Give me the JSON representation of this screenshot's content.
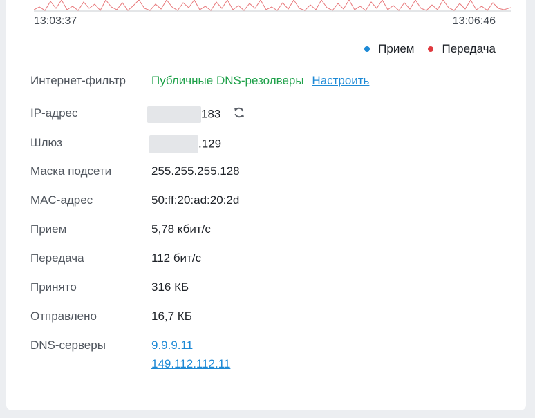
{
  "chart": {
    "time_start": "13:03:37",
    "time_end": "13:06:46",
    "legend": [
      {
        "label": "Прием",
        "color": "#1e8ad6"
      },
      {
        "label": "Передача",
        "color": "#e0393e"
      }
    ]
  },
  "info": {
    "filter_label": "Интернет-фильтр",
    "filter_value": "Публичные DNS-резолверы",
    "filter_link": "Настроить",
    "ip_label": "IP-адрес",
    "ip_suffix": "183",
    "gateway_label": "Шлюз",
    "gateway_suffix": ".129",
    "mask_label": "Маска подсети",
    "mask_value": "255.255.255.128",
    "mac_label": "MAC-адрес",
    "mac_value": "50:ff:20:ad:20:2d",
    "rx_label": "Прием",
    "rx_value": "5,78 кбит/с",
    "tx_label": "Передача",
    "tx_value": "112 бит/с",
    "received_label": "Принято",
    "received_value": "316 КБ",
    "sent_label": "Отправлено",
    "sent_value": "16,7 КБ",
    "dns_label": "DNS-серверы",
    "dns_servers": [
      "9.9.9.11",
      "149.112.112.11"
    ]
  },
  "icons": {
    "refresh": "refresh-icon"
  }
}
